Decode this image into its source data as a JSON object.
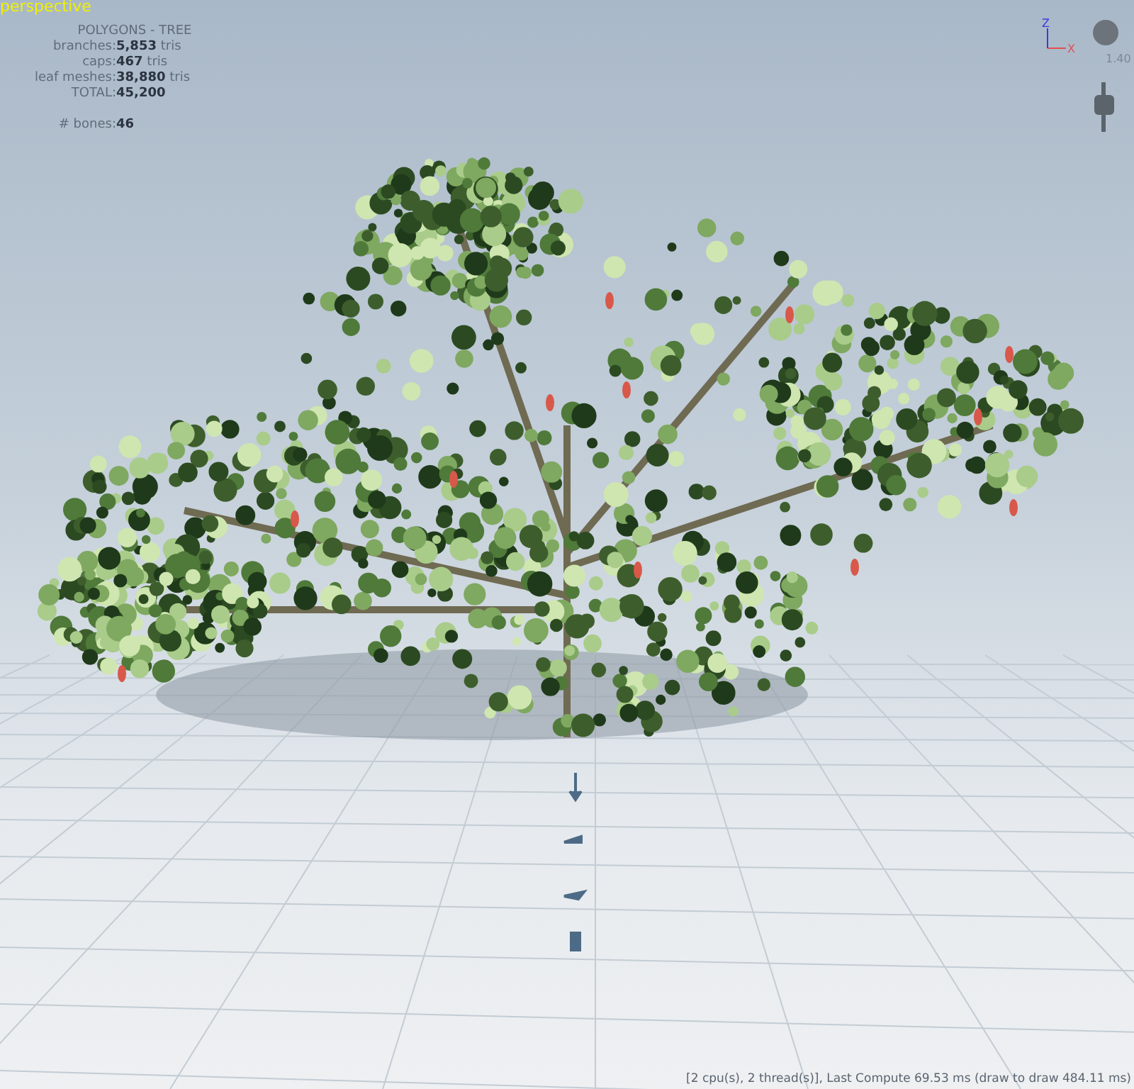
{
  "viewport": {
    "label": "perspective"
  },
  "stats": {
    "title": "POLYGONS - TREE",
    "rows": [
      {
        "label": "branches:",
        "value": "5,853",
        "unit": "tris"
      },
      {
        "label": "caps:",
        "value": "467",
        "unit": "tris"
      },
      {
        "label": "leaf meshes:",
        "value": "38,880",
        "unit": "tris"
      },
      {
        "label": "TOTAL:",
        "value": "45,200"
      }
    ],
    "bones": {
      "label": "# bones:",
      "value": "46"
    }
  },
  "axis": {
    "vertical": "Z",
    "horizontal": "X"
  },
  "zoom": {
    "value": "1.40"
  },
  "status_bar": "[2 cpu(s), 2 thread(s)], Last Compute 69.53 ms (draw to draw 484.11 ms)"
}
